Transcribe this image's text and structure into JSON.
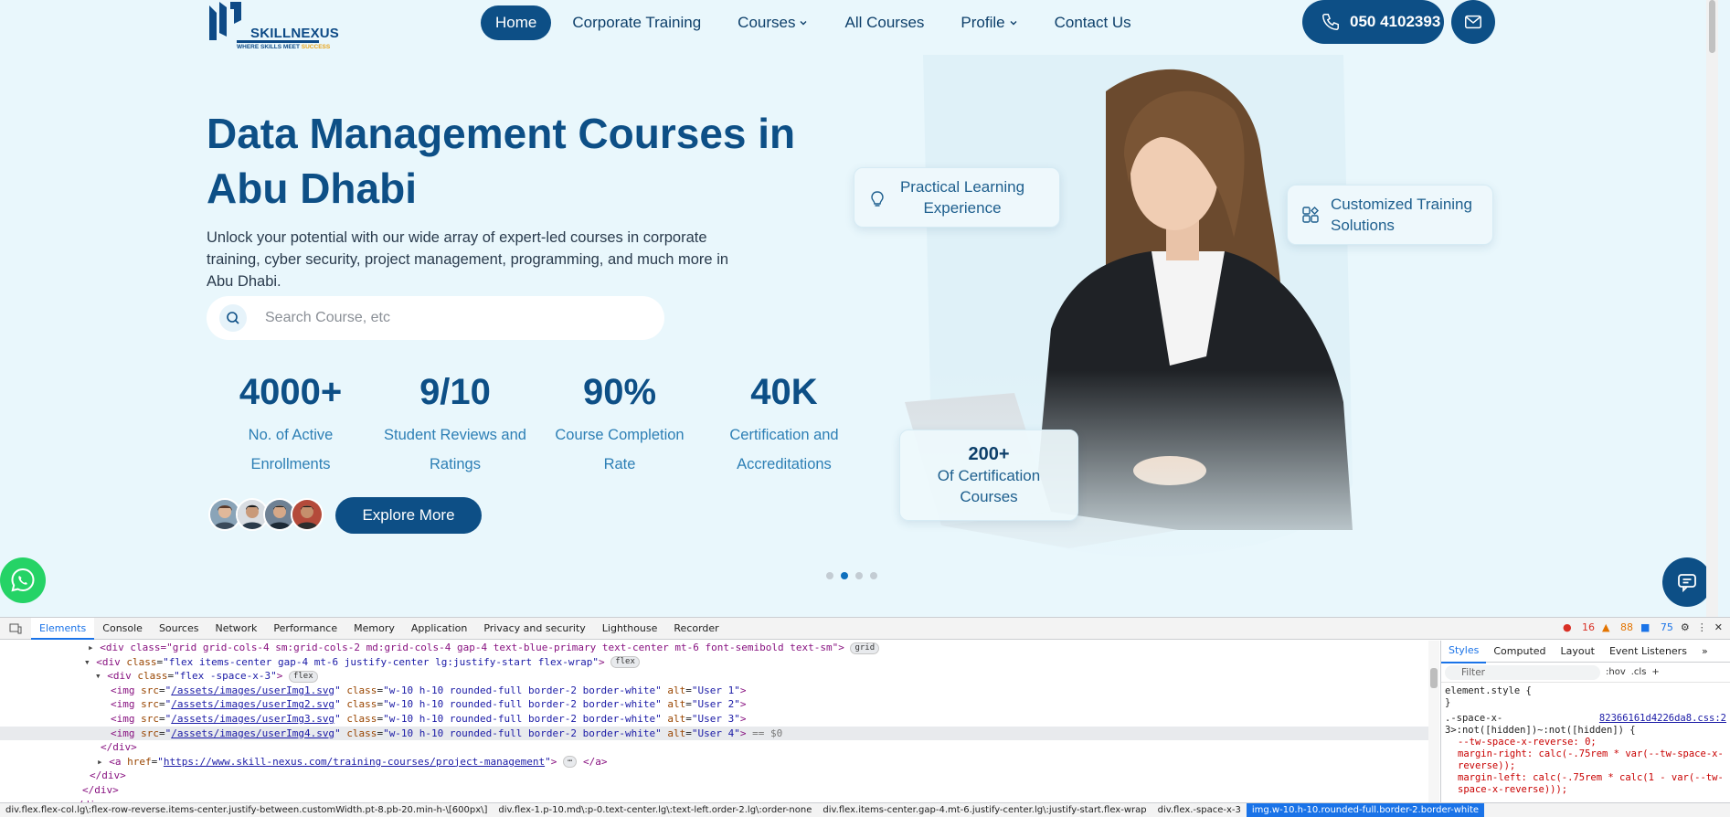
{
  "site": {
    "logo": {
      "name": "SKILLNEXUS",
      "tagline_a": "WHERE SKILLS MEET ",
      "tagline_b": "SUCCESS"
    },
    "nav": [
      {
        "label": "Home",
        "active": true,
        "dropdown": false
      },
      {
        "label": "Corporate Training",
        "active": false,
        "dropdown": false
      },
      {
        "label": "Courses",
        "active": false,
        "dropdown": true
      },
      {
        "label": "All Courses",
        "active": false,
        "dropdown": false
      },
      {
        "label": "Profile",
        "active": false,
        "dropdown": true
      },
      {
        "label": "Contact Us",
        "active": false,
        "dropdown": false
      }
    ],
    "phone": "050 4102393",
    "hero": {
      "title": "Data Management Courses in Abu Dhabi",
      "subtitle": "Unlock your potential with our wide array of expert-led courses in corporate training, cyber security, project management, programming, and much more in Abu Dhabi.",
      "search_placeholder": "Search Course, etc",
      "explore": "Explore More"
    },
    "stats": [
      {
        "num": "4000+",
        "label": "No. of Active Enrollments"
      },
      {
        "num": "9/10",
        "label": "Student Reviews and Ratings"
      },
      {
        "num": "90%",
        "label": "Course Completion Rate"
      },
      {
        "num": "40K",
        "label": "Certification and Accreditations"
      }
    ],
    "badges": {
      "practical": "Practical Learning Experience",
      "customized": "Customized Training Solutions",
      "cert_count": "200+",
      "cert_label": "Of Certification Courses"
    },
    "carousel": {
      "count": 4,
      "active": 1
    },
    "colors": {
      "primary": "#0d4f86",
      "accent": "#e8a317",
      "background": "#e9f7fc",
      "whatsapp": "#25d366"
    }
  },
  "devtools": {
    "tabs": [
      "Elements",
      "Console",
      "Sources",
      "Network",
      "Performance",
      "Memory",
      "Application",
      "Privacy and security",
      "Lighthouse",
      "Recorder"
    ],
    "active_tab": "Elements",
    "errors": "16",
    "warnings": "88",
    "infos": "75",
    "dom": {
      "l0": "<div class=\"grid grid-cols-4 sm:grid-cols-2 md:grid-cols-4 gap-4 text-blue-primary text-center mt-6 font-semibold text-sm\">",
      "l1_class": "flex items-center gap-4 mt-6 justify-center lg:justify-start flex-wrap",
      "l2_class": "flex -space-x-3",
      "img_class": "w-10 h-10 rounded-full border-2 border-white",
      "imgs": [
        {
          "src": "/assets/images/userImg1.svg",
          "alt": "User 1"
        },
        {
          "src": "/assets/images/userImg2.svg",
          "alt": "User 2"
        },
        {
          "src": "/assets/images/userImg3.svg",
          "alt": "User 3"
        },
        {
          "src": "/assets/images/userImg4.svg",
          "alt": "User 4"
        }
      ],
      "href": "https://www.skill-nexus.com/training-courses/project-management",
      "pill_grid": "grid",
      "pill_flex": "flex",
      "eq": "== $0"
    },
    "styles": {
      "tabs": [
        "Styles",
        "Computed",
        "Layout",
        "Event Listeners"
      ],
      "active": "Styles",
      "filter_placeholder": "Filter",
      "hov": ":hov",
      "cls": ".cls",
      "element_style": "element.style {",
      "close": "}",
      "selector": ".-space-x-3>:not([hidden])~:not([hidden]) {",
      "source": "82366161d4226da8.css:2",
      "decl1": "--tw-space-x-reverse: 0;",
      "decl2": "margin-right: calc(-.75rem * var(--tw-space-x-reverse));",
      "decl3": "margin-left: calc(-.75rem * calc(1 - var(--tw-space-x-reverse)));"
    },
    "breadcrumbs": [
      "div.flex.flex-col.lg\\:flex-row-reverse.items-center.justify-between.customWidth.pt-8.pb-20.min-h-\\[600px\\]",
      "div.flex-1.p-10.md\\:p-0.text-center.lg\\:text-left.order-2.lg\\:order-none",
      "div.flex.items-center.gap-4.mt-6.justify-center.lg\\:justify-start.flex-wrap",
      "div.flex.-space-x-3",
      "img.w-10.h-10.rounded-full.border-2.border-white"
    ]
  }
}
